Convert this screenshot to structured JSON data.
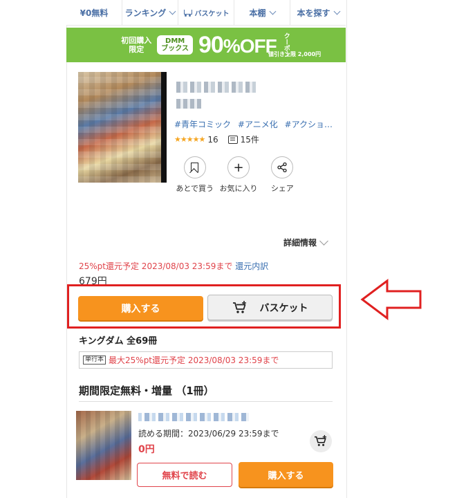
{
  "nav": {
    "items": [
      {
        "label": "¥0無料",
        "icon": ""
      },
      {
        "label": "ランキング",
        "icon": "chevron-down-icon"
      },
      {
        "label": "バスケット",
        "icon": "cart-icon"
      },
      {
        "label": "本棚",
        "icon": "chevron-down-icon"
      },
      {
        "label": "本を探す",
        "icon": "chevron-down-icon"
      }
    ]
  },
  "banner": {
    "first_purchase_line1": "初回購入",
    "first_purchase_line2": "限定",
    "dmm_line1": "DMM",
    "dmm_line2": "ブックス",
    "discount": "90",
    "percent_off": "%OFF",
    "coupon": "クーポン",
    "cap": "値引き上限 2,000円",
    "color": "#7ac143"
  },
  "product": {
    "tags": [
      "#青年コミック",
      "#アニメ化",
      "#アクショ…"
    ],
    "review_count": "16",
    "comment_count": "15件",
    "actions": [
      {
        "label": "あとで買う",
        "icon": "bookmark-icon"
      },
      {
        "label": "お気に入り",
        "icon": "plus-icon"
      },
      {
        "label": "シェア",
        "icon": "share-icon"
      }
    ],
    "detail_label": "詳細情報",
    "points_text": "25%pt還元予定 2023/08/03 23:59まで",
    "points_link": "還元内訳",
    "price": "679円",
    "buy_label": "購入する",
    "basket_label": "バスケット"
  },
  "series": {
    "name": "キングダム",
    "count": "全69冊",
    "format_tag": "単行本",
    "format_points": "最大25%pt還元予定 2023/08/03 23:59まで"
  },
  "limited": {
    "title": "期間限定無料・増量 （1冊）",
    "read_period": "読める期間：2023/06/29 23:59まで",
    "price": "0円",
    "free_read_label": "無料で読む",
    "buy_label": "購入する"
  },
  "colors": {
    "accent_orange": "#f7931e",
    "alert_red": "#e0434a",
    "link_blue": "#3a6fb0",
    "highlight_red": "#e02020"
  }
}
